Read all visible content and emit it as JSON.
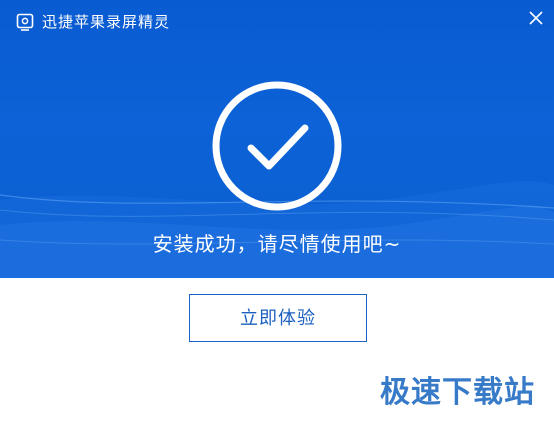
{
  "window": {
    "title": "迅捷苹果录屏精灵",
    "icon": "screen-record-icon",
    "close_icon": "close-icon"
  },
  "hero": {
    "status_icon": "check-circle-icon",
    "message": "安装成功，请尽情使用吧~"
  },
  "actions": {
    "try_label": "立即体验"
  },
  "watermark": {
    "text": "极速下载站"
  },
  "colors": {
    "hero_blue": "#0c62d6",
    "button_border": "#1b63c7",
    "watermark_blue": "#2d73c6"
  }
}
